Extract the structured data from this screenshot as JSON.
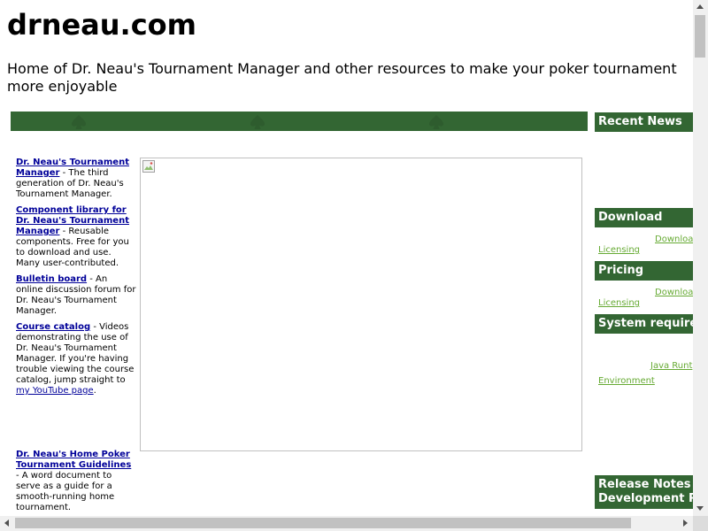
{
  "header": {
    "site_title": "drneau.com",
    "tagline": "Home of Dr. Neau's Tournament Manager and other resources to make your poker tournament more enjoyable"
  },
  "left_nav": {
    "items": [
      {
        "link": "Dr. Neau's Tournament Manager",
        "description": " - The third generation of Dr. Neau's Tournament Manager."
      },
      {
        "link": "Component library for Dr. Neau's Tournament Manager",
        "description": " - Reusable components. Free for you to download and use. Many user-contributed."
      },
      {
        "link": "Bulletin board",
        "description": " - An online discussion forum for Dr. Neau's Tournament Manager."
      },
      {
        "link": "Course catalog",
        "description": " - Videos demonstrating the use of Dr. Neau's Tournament Manager. If you're having trouble viewing the course catalog, jump straight to ",
        "extra_link": "my YouTube page",
        "suffix": "."
      },
      {
        "link": "Dr. Neau's Home Poker Tournament Guidelines",
        "description": " - A word document to serve as a guide for a smooth-running home tournament."
      }
    ]
  },
  "sidebar": {
    "recent_news": "Recent News",
    "download": {
      "heading": "Download",
      "link1": "Downloa",
      "link2": "Licensing"
    },
    "pricing": {
      "heading": "Pricing",
      "link1": "Downloa",
      "link2": "Licensing"
    },
    "system_requirements": {
      "heading": "System require",
      "link1": "Java Runt",
      "link2": "Environment "
    },
    "release_notes": {
      "line1": "Release Notes",
      "line2": "Development P"
    }
  },
  "colors": {
    "banner_green": "#336633",
    "link_blue": "#000099",
    "sidebar_link_green": "#66aa33"
  },
  "icons": {
    "broken_image": "broken-image-icon",
    "spade_watermark": "spade-icon"
  }
}
